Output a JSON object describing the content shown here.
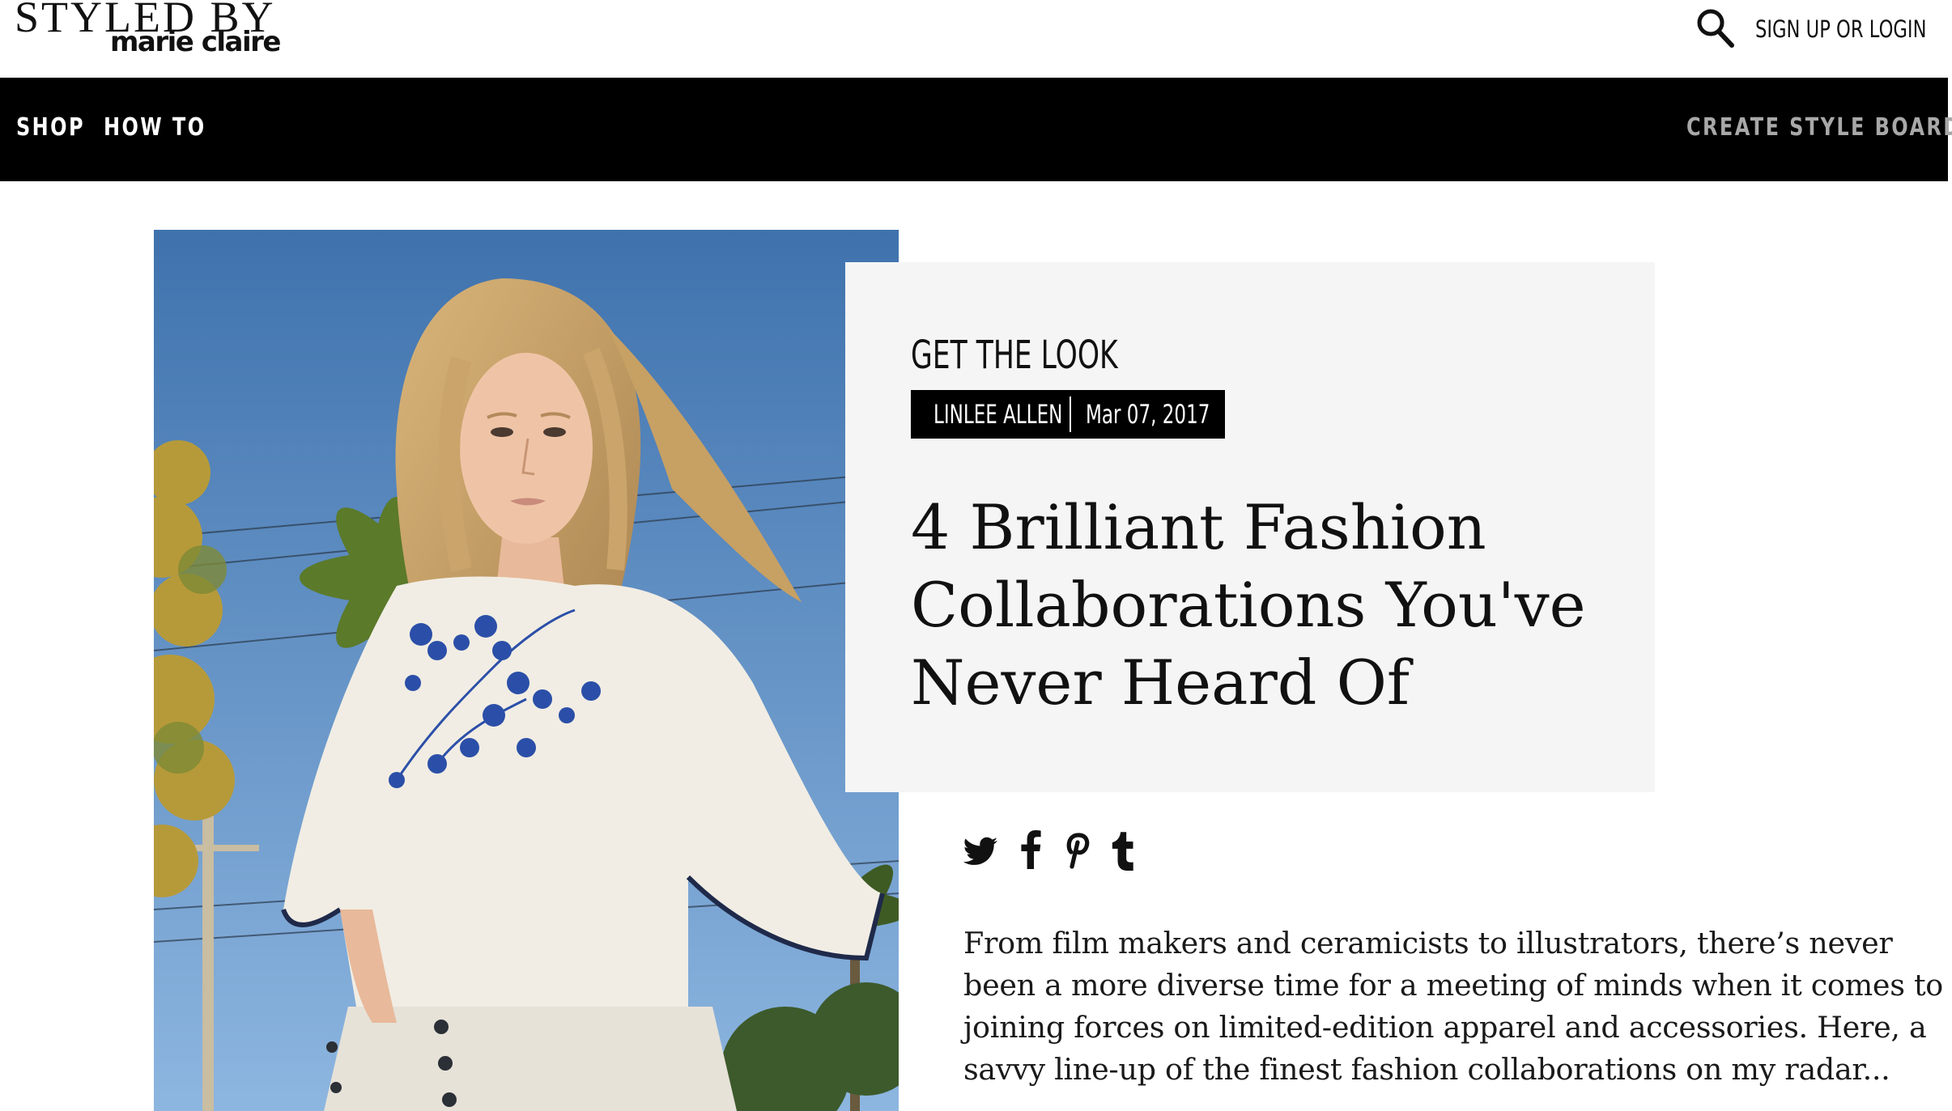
{
  "header": {
    "logo_line1": "STYLED BY",
    "logo_line2": "marie claire",
    "search_icon": "search-icon",
    "auth_label": "SIGN UP OR LOGIN"
  },
  "nav": {
    "items": [
      {
        "label": "SHOP"
      },
      {
        "label": "HOW TO"
      }
    ],
    "create_label": "CREATE STYLE BOARD"
  },
  "article": {
    "category": "GET THE LOOK",
    "author": "LINLEE ALLEN",
    "date": "Mar 07, 2017",
    "title": "4 Brilliant Fashion Collaborations You've Never Heard Of",
    "intro": "From film makers and ceramicists to illustrators, there’s never been a more diverse time for a meeting of minds when it comes to joining forces on limited-edition apparel and accessories. Here, a savvy line-up of the finest fashion collaborations on my radar..."
  },
  "share": {
    "icons": [
      "twitter-icon",
      "facebook-icon",
      "pinterest-icon",
      "tumblr-icon"
    ]
  },
  "colors": {
    "nav_background": "#000000",
    "nav_text": "#ffffff",
    "nav_muted": "#a8a8a8",
    "card_background": "#f5f5f5",
    "sky_top": "#3f72ad",
    "sky_bottom": "#8db6e0"
  }
}
